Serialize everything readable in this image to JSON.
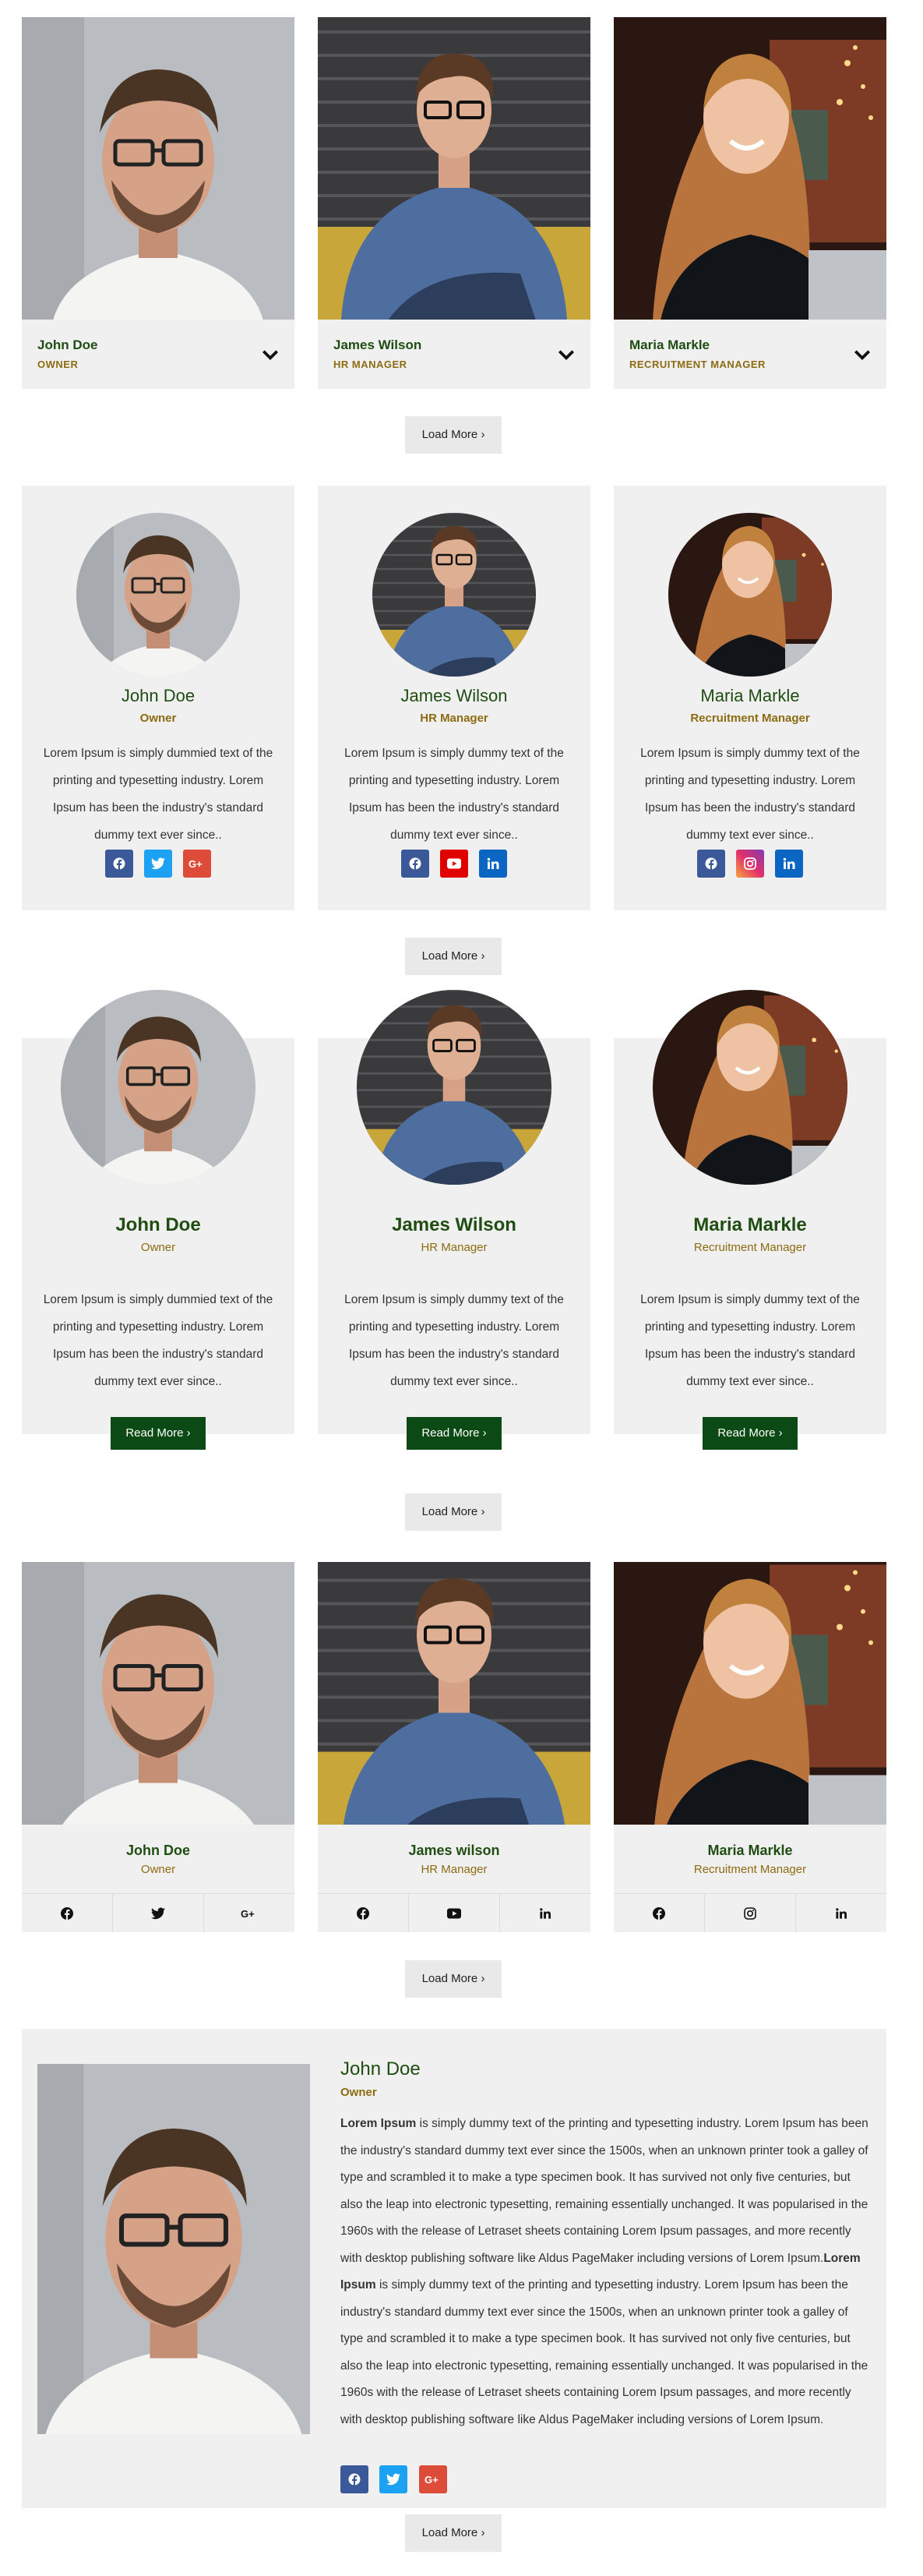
{
  "load_more_label": "Load More ›",
  "read_more_label": "Read More ›",
  "members": [
    {
      "name": "John Doe",
      "role": "Owner",
      "role_upper": "OWNER"
    },
    {
      "name": "James Wilson",
      "role": "HR Manager",
      "role_upper": "HR MANAGER"
    },
    {
      "name": "Maria Markle",
      "role": "Recruitment Manager",
      "role_upper": "RECRUITMENT MANAGER"
    }
  ],
  "section2": {
    "descriptions": [
      "Lorem Ipsum is simply dummied text of the printing and typesetting industry. Lorem Ipsum has been the industry's standard dummy text ever since..",
      "Lorem Ipsum is simply dummy text of the printing and typesetting industry. Lorem Ipsum has been the industry's standard dummy text ever since..",
      "Lorem Ipsum is simply dummy text of the printing and typesetting industry. Lorem Ipsum has been the industry's standard dummy text ever since.."
    ]
  },
  "section4": {
    "names": [
      "John Doe",
      "James wilson",
      "Maria Markle"
    ]
  },
  "section5": {
    "name": "John Doe",
    "role": "Owner",
    "bold_1": "Lorem Ipsum",
    "text_1": " is simply dummy text of the printing and typesetting industry. Lorem Ipsum has been the industry's standard dummy text ever since the 1500s, when an unknown printer took a galley of type and scrambled it to make a type specimen book. It has survived not only five centuries, but also the leap into electronic typesetting, remaining essentially unchanged. It was popularised in the 1960s with the release of Letraset sheets containing Lorem Ipsum passages, and more recently with desktop publishing software like Aldus PageMaker including versions of Lorem Ipsum.",
    "bold_2": "Lorem Ipsum",
    "text_2": " is simply dummy text of the printing and typesetting industry. Lorem Ipsum has been the industry's standard dummy text ever since the 1500s, when an unknown printer took a galley of type and scrambled it to make a type specimen book. It has survived not only five centuries, but also the leap into electronic typesetting, remaining essentially unchanged. It was popularised in the 1960s with the release of Letraset sheets containing Lorem Ipsum passages, and more recently with desktop publishing software like Aldus PageMaker including versions of Lorem Ipsum."
  },
  "colors": {
    "card_bg": "#f0f0f0",
    "name_green": "#1f4d12",
    "role_gold": "#8c6b12",
    "read_more_bg": "#0b4a14",
    "facebook": "#3b5998",
    "twitter": "#1da1f2",
    "google_plus": "#dd4b39",
    "youtube": "#e00000",
    "linkedin": "#0a66c2"
  },
  "icons": [
    "chevron-down-icon",
    "facebook-icon",
    "twitter-icon",
    "google-plus-icon",
    "youtube-icon",
    "linkedin-icon",
    "instagram-icon"
  ]
}
